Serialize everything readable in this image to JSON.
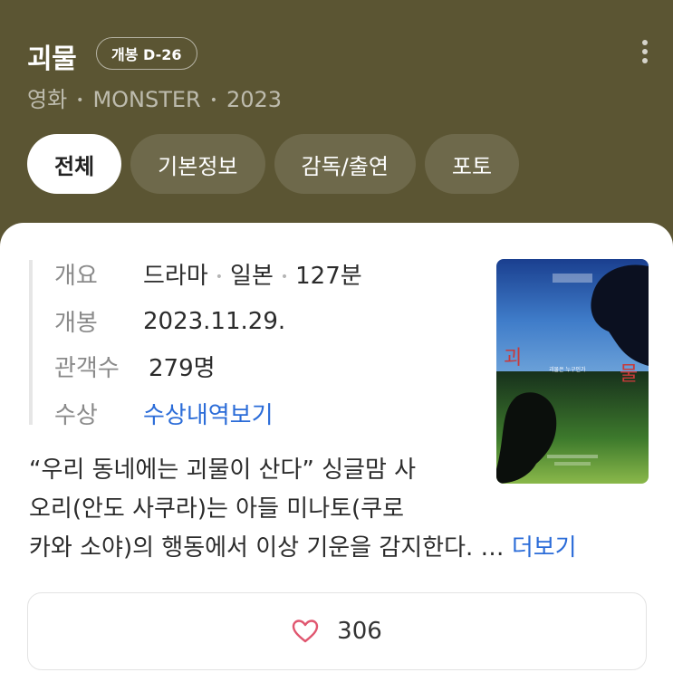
{
  "header": {
    "title": "괴물",
    "release_badge": "개봉 D-26",
    "subtitle": {
      "category": "영화",
      "original_title": "MONSTER",
      "year": "2023"
    },
    "more_icon": "more-vertical-icon"
  },
  "tabs": [
    {
      "label": "전체",
      "active": true
    },
    {
      "label": "기본정보",
      "active": false
    },
    {
      "label": "감독/출연",
      "active": false
    },
    {
      "label": "포토",
      "active": false
    }
  ],
  "info": {
    "overview": {
      "key": "개요",
      "genre": "드라마",
      "country": "일본",
      "runtime": "127분"
    },
    "release": {
      "key": "개봉",
      "value": "2023.11.29."
    },
    "audience": {
      "key": "관객수",
      "value": "279명"
    },
    "awards": {
      "key": "수상",
      "link": "수상내역보기"
    }
  },
  "poster": {
    "title_chars": [
      "괴",
      "물"
    ],
    "tagline": "괴물은 누구인가"
  },
  "synopsis": {
    "lines": [
      "“우리 동네에는 괴물이 산다” 싱글맘 사",
      "오리(안도 사쿠라)는 아들 미나토(쿠로",
      "카와 소야)의 행동에서 이상 기운을 감지한다. … "
    ],
    "more_label": "더보기"
  },
  "like": {
    "count": "306",
    "icon": "heart-outline-icon"
  },
  "colors": {
    "header_bg": "#5b5533",
    "link": "#2b6cd8",
    "heart": "#e0566f"
  }
}
